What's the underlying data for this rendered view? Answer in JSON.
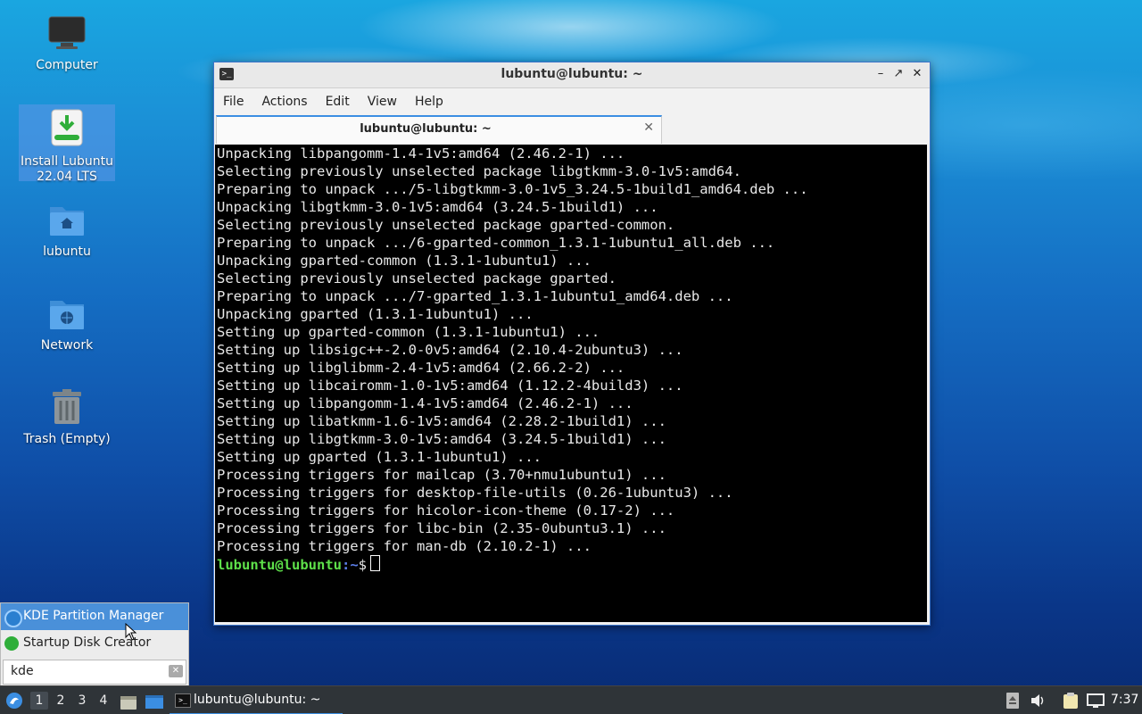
{
  "desktop": {
    "icons": [
      {
        "label": "Computer"
      },
      {
        "label": "Install Lubuntu 22.04 LTS"
      },
      {
        "label": "lubuntu"
      },
      {
        "label": "Network"
      },
      {
        "label": "Trash (Empty)"
      }
    ]
  },
  "window": {
    "title": "lubuntu@lubuntu: ~",
    "menu": [
      "File",
      "Actions",
      "Edit",
      "View",
      "Help"
    ],
    "tab_title": "lubuntu@lubuntu: ~",
    "terminal_lines": [
      "Unpacking libpangomm-1.4-1v5:amd64 (2.46.2-1) ...",
      "Selecting previously unselected package libgtkmm-3.0-1v5:amd64.",
      "Preparing to unpack .../5-libgtkmm-3.0-1v5_3.24.5-1build1_amd64.deb ...",
      "Unpacking libgtkmm-3.0-1v5:amd64 (3.24.5-1build1) ...",
      "Selecting previously unselected package gparted-common.",
      "Preparing to unpack .../6-gparted-common_1.3.1-1ubuntu1_all.deb ...",
      "Unpacking gparted-common (1.3.1-1ubuntu1) ...",
      "Selecting previously unselected package gparted.",
      "Preparing to unpack .../7-gparted_1.3.1-1ubuntu1_amd64.deb ...",
      "Unpacking gparted (1.3.1-1ubuntu1) ...",
      "Setting up gparted-common (1.3.1-1ubuntu1) ...",
      "Setting up libsigc++-2.0-0v5:amd64 (2.10.4-2ubuntu3) ...",
      "Setting up libglibmm-2.4-1v5:amd64 (2.66.2-2) ...",
      "Setting up libcairomm-1.0-1v5:amd64 (1.12.2-4build3) ...",
      "Setting up libpangomm-1.4-1v5:amd64 (2.46.2-1) ...",
      "Setting up libatkmm-1.6-1v5:amd64 (2.28.2-1build1) ...",
      "Setting up libgtkmm-3.0-1v5:amd64 (3.24.5-1build1) ...",
      "Setting up gparted (1.3.1-1ubuntu1) ...",
      "Processing triggers for mailcap (3.70+nmu1ubuntu1) ...",
      "Processing triggers for desktop-file-utils (0.26-1ubuntu3) ...",
      "Processing triggers for hicolor-icon-theme (0.17-2) ...",
      "Processing triggers for libc-bin (2.35-0ubuntu3.1) ...",
      "Processing triggers for man-db (2.10.2-1) ..."
    ],
    "prompt_user": "lubuntu@lubuntu",
    "prompt_path": ":~",
    "prompt_symbol": "$"
  },
  "launcher": {
    "results": [
      "KDE Partition Manager",
      "Startup Disk Creator"
    ],
    "search_value": "kde"
  },
  "taskbar": {
    "desktops": [
      "1",
      "2",
      "3",
      "4"
    ],
    "task_label": "lubuntu@lubuntu: ~",
    "clock": "7:37"
  },
  "colors": {
    "accent": "#3b8ee2",
    "prompt_user": "#5ee04a",
    "prompt_path": "#5b7ee8"
  }
}
